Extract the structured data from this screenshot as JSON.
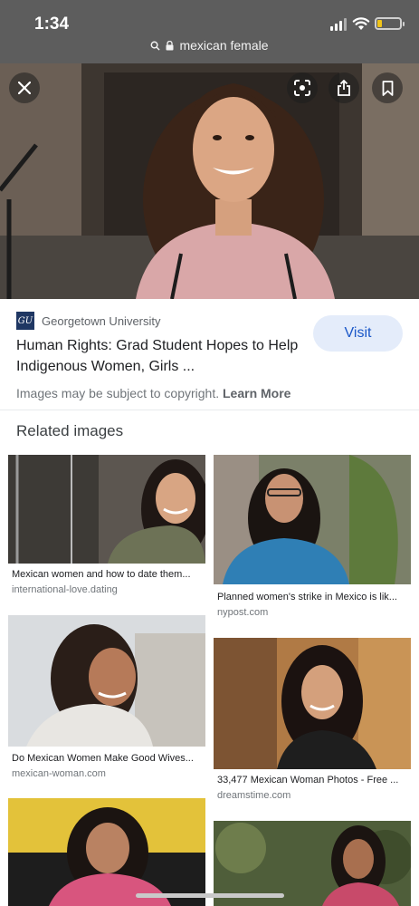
{
  "status": {
    "time": "1:34"
  },
  "url_bar": {
    "query": "mexican female"
  },
  "hero": {
    "close_icon": "close-icon",
    "lens_icon": "lens-icon",
    "share_icon": "share-icon",
    "bookmark_icon": "bookmark-icon"
  },
  "source": {
    "logo_text": "GU",
    "name": "Georgetown University"
  },
  "result": {
    "title_line1": "Human Rights: Grad Student Hopes to Help",
    "title_line2": "Indigenous Women, Girls ...",
    "visit_label": "Visit",
    "copyright_text": "Images may be subject to copyright.",
    "learn_more": "Learn More"
  },
  "related": {
    "heading": "Related images",
    "items": [
      {
        "caption": "Mexican women and how to date them...",
        "domain": "international-love.dating"
      },
      {
        "caption": "Planned women's strike in Mexico is lik...",
        "domain": "nypost.com"
      },
      {
        "caption": "Do Mexican Women Make Good Wives...",
        "domain": "mexican-woman.com"
      },
      {
        "caption": "33,477 Mexican Woman Photos - Free ...",
        "domain": "dreamstime.com"
      },
      {
        "caption": "",
        "domain": ""
      },
      {
        "caption": "",
        "domain": ""
      }
    ]
  },
  "colors": {
    "topbar": "#5d5d5d",
    "visit_bg": "#e4ecfa",
    "visit_text": "#1a57c8",
    "battery": "#f0c419"
  }
}
